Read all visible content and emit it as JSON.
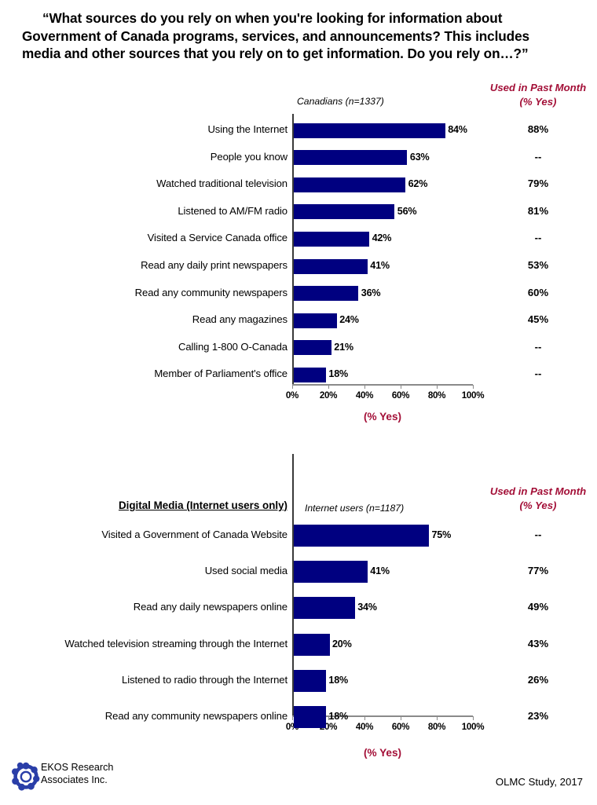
{
  "title": {
    "line1": "“What sources do you rely on when you're looking for information about",
    "line2": "Government of Canada programs, services, and announcements? This includes",
    "line3": "media and other sources that you rely on to get information. Do you rely on…?”"
  },
  "colors": {
    "bar": "#000080",
    "accent_red": "#A30F37",
    "axis": "#8a8a8a",
    "text": "#000000"
  },
  "footer": {
    "logo_icon": "ekos-chain-logo-icon",
    "org_line1": "EKOS Research",
    "org_line2": "Associates Inc.",
    "source": "OLMC Study, 2017"
  },
  "chart_data": [
    {
      "type": "bar",
      "orientation": "horizontal",
      "id": "all-canadians",
      "title": "",
      "sample_label": "Canadians (n=1337)",
      "right_column_header_line1": "Used in Past Month",
      "right_column_header_line2": "(% Yes)",
      "xlabel": "(% Yes)",
      "ylabel": "",
      "xlim": [
        0,
        100
      ],
      "xticks": [
        0,
        20,
        40,
        60,
        80,
        100
      ],
      "xticklabels": [
        "0%",
        "20%",
        "40%",
        "60%",
        "80%",
        "100%"
      ],
      "grid": false,
      "legend": "none",
      "categories": [
        "Using the Internet",
        "People you know",
        "Watched traditional television",
        "Listened to AM/FM radio",
        "Visited a Service Canada office",
        "Read any daily print newspapers",
        "Read any community newspapers",
        "Read any magazines",
        "Calling 1-800 O-Canada",
        "Member of Parliament's office"
      ],
      "values": [
        84,
        63,
        62,
        56,
        42,
        41,
        36,
        24,
        21,
        18
      ],
      "value_labels": [
        "84%",
        "63%",
        "62%",
        "56%",
        "42%",
        "41%",
        "36%",
        "24%",
        "21%",
        "18%"
      ],
      "used_past_month": [
        "88%",
        "--",
        "79%",
        "81%",
        "--",
        "53%",
        "60%",
        "45%",
        "--",
        "--"
      ]
    },
    {
      "type": "bar",
      "orientation": "horizontal",
      "id": "digital-media",
      "section_header": "Digital Media (Internet users only)",
      "sample_label": "Internet users (n=1187)",
      "right_column_header_line1": "Used in Past Month",
      "right_column_header_line2": "(% Yes)",
      "xlabel": "(% Yes)",
      "ylabel": "",
      "xlim": [
        0,
        100
      ],
      "xticks": [
        0,
        20,
        40,
        60,
        80,
        100
      ],
      "xticklabels": [
        "0%",
        "20%",
        "40%",
        "60%",
        "80%",
        "100%"
      ],
      "grid": false,
      "legend": "none",
      "categories": [
        "Visited a Government of Canada Website",
        "Used social media",
        "Read any daily newspapers online",
        "Watched television streaming through the Internet",
        "Listened to radio through the Internet",
        "Read any community newspapers online"
      ],
      "values": [
        75,
        41,
        34,
        20,
        18,
        18
      ],
      "value_labels": [
        "75%",
        "41%",
        "34%",
        "20%",
        "18%",
        "18%"
      ],
      "used_past_month": [
        "--",
        "77%",
        "49%",
        "43%",
        "26%",
        "23%"
      ]
    }
  ]
}
